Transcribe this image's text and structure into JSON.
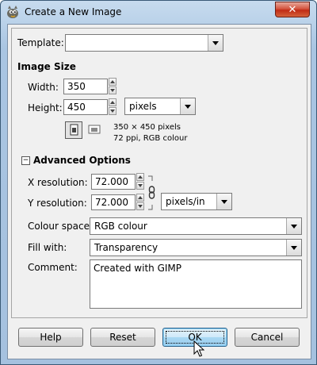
{
  "window": {
    "title": "Create a New Image",
    "close_glyph": "✕"
  },
  "template": {
    "label": "Template:",
    "value": ""
  },
  "image_size": {
    "heading": "Image Size",
    "width_label": "Width:",
    "width_value": "350",
    "height_label": "Height:",
    "height_value": "450",
    "unit": "pixels",
    "info_line1": "350 × 450 pixels",
    "info_line2": "72 ppi, RGB colour"
  },
  "advanced": {
    "expander_glyph": "−",
    "heading": "Advanced Options",
    "x_res_label": "X resolution:",
    "x_res_value": "72.000",
    "y_res_label": "Y resolution:",
    "y_res_value": "72.000",
    "res_unit": "pixels/in",
    "colour_space_label": "Colour space:",
    "colour_space_value": "RGB colour",
    "fill_label": "Fill with:",
    "fill_value": "Transparency",
    "comment_label": "Comment:",
    "comment_value": "Created with GIMP"
  },
  "buttons": {
    "help": "Help",
    "reset": "Reset",
    "ok": "OK",
    "cancel": "Cancel"
  },
  "colors": {
    "titlebar": "#bcd3ea",
    "client": "#f0f0f0",
    "close": "#c9361c",
    "ok_button": "#99cdee"
  },
  "icons": [
    "wilber-icon",
    "close-icon",
    "spin-up-icon",
    "spin-down-icon",
    "chevron-down-icon",
    "portrait-icon",
    "landscape-icon",
    "chain-link-icon",
    "collapse-icon",
    "mouse-cursor-icon"
  ]
}
